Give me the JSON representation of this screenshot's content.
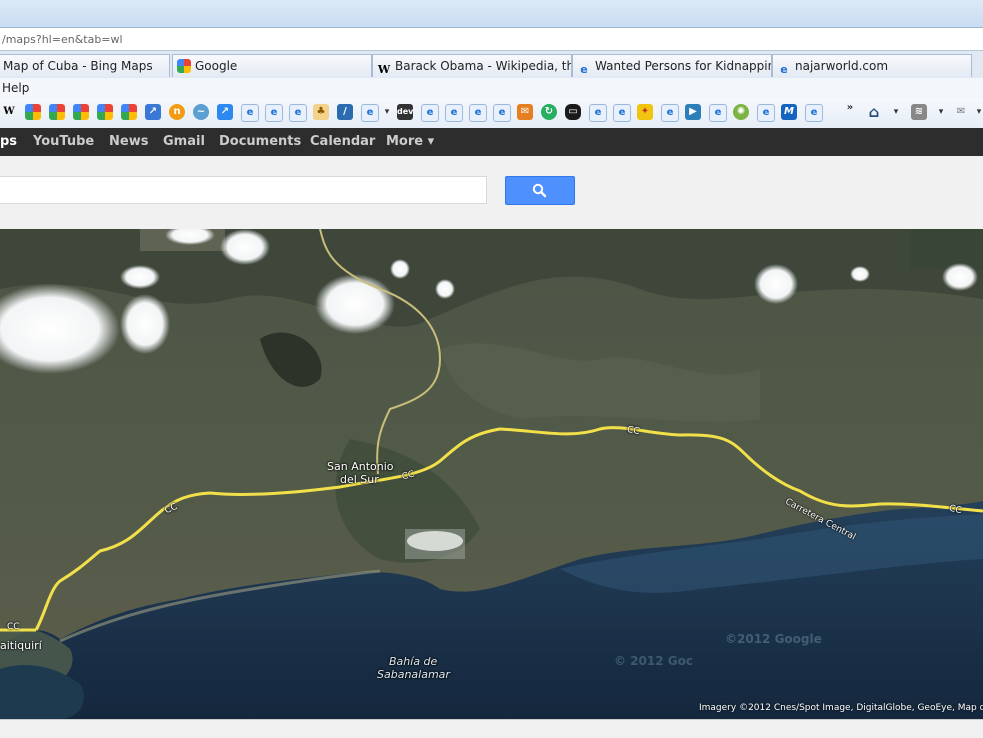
{
  "browser": {
    "address_url": "/maps?hl=en&tab=wl",
    "tabs": [
      {
        "label": "Map of Cuba - Bing Maps",
        "icon": "bing-icon"
      },
      {
        "label": "Google",
        "icon": "google-icon"
      },
      {
        "label": "Barack Obama - Wikipedia, th...",
        "icon": "wikipedia-icon"
      },
      {
        "label": "Wanted Persons for Kidnapping",
        "icon": "ie-page-icon"
      },
      {
        "label": "najarworld.com",
        "icon": "ie-page-icon"
      }
    ],
    "menu": {
      "help_label": "Help"
    }
  },
  "google_bar": {
    "items": [
      "ps",
      "YouTube",
      "News",
      "Gmail",
      "Documents",
      "Calendar",
      "More ▾"
    ]
  },
  "search": {
    "value": "",
    "button_icon": "search-icon",
    "button_color": "#4d90fe"
  },
  "map": {
    "place_labels": {
      "town_line1": "San Antonio",
      "town_line2": "del Sur",
      "bay_line1": "Bahía de",
      "bay_line2": "Sabanalamar",
      "left_town": "aitiquirí"
    },
    "road_labels": {
      "cc1": "CC",
      "cc2": "CC",
      "cc3": "CC",
      "cc4": "CC",
      "cc5": "CC",
      "carretera": "Carretera Central"
    },
    "attribution": "Imagery ©2012 Cnes/Spot Image, DigitalGlobe, GeoEye, Map d",
    "watermark1": "©2012 Google",
    "watermark2": "© 2012 Goc",
    "road_color": "#f2e04a"
  }
}
